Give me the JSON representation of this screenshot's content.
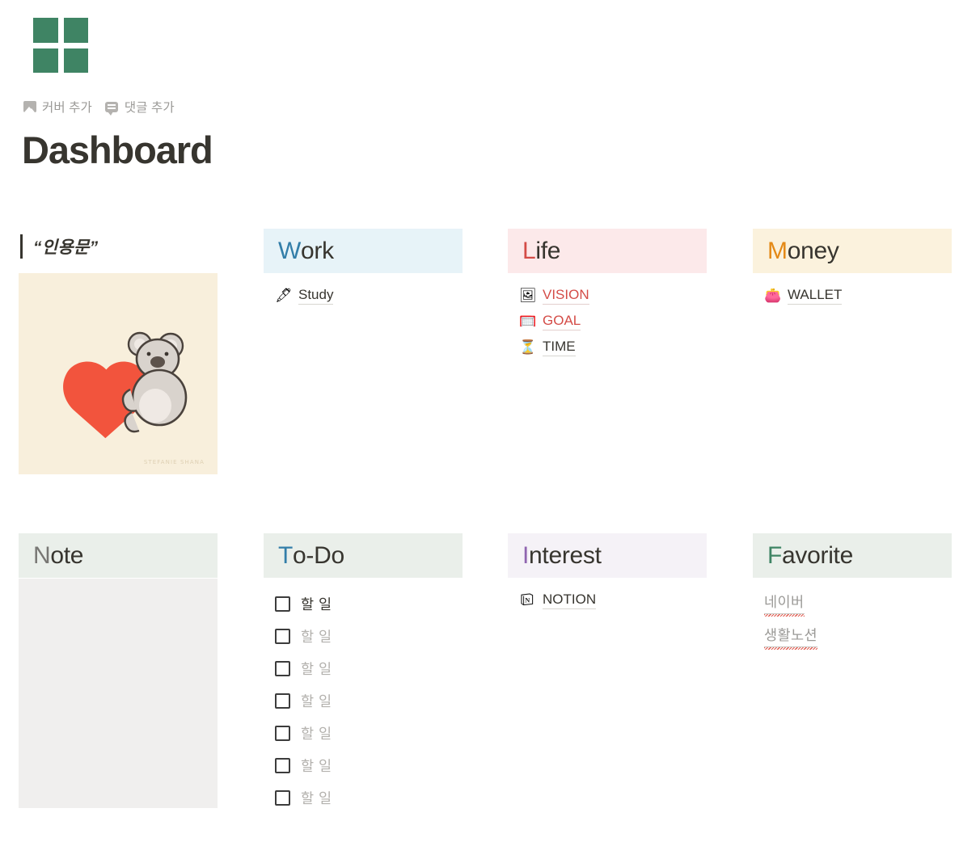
{
  "page": {
    "icon_name": "four-square-grid-icon",
    "icon_color": "#3f8464",
    "title": "Dashboard",
    "meta": [
      {
        "icon": "image-icon",
        "label": "커버 추가"
      },
      {
        "icon": "comment-bubble-icon",
        "label": "댓글 추가"
      }
    ]
  },
  "quote": {
    "text": "“인용문”"
  },
  "art": {
    "alt": "koala hugging a red heart illustration",
    "background": "#f8efdc",
    "watermark": "STEFANIE SHANA"
  },
  "sections": {
    "work": {
      "title_first": "W",
      "title_rest": "ork",
      "accent": "#337ea9",
      "bg": "#e7f3f8",
      "items": [
        {
          "icon": "🖋",
          "icon_name": "fountain-pen-icon",
          "label": "Study",
          "color": "dark"
        }
      ]
    },
    "life": {
      "title_first": "L",
      "title_rest": "ife",
      "accent": "#d44c47",
      "bg": "#fce9ea",
      "items": [
        {
          "icon": "🖼",
          "icon_name": "framed-picture-icon",
          "label": "VISION",
          "color": "red"
        },
        {
          "icon": "🥅",
          "icon_name": "goal-net-icon",
          "label": "GOAL",
          "color": "red"
        },
        {
          "icon": "⏳",
          "icon_name": "hourglass-icon",
          "label": "TIME",
          "color": "dark"
        }
      ]
    },
    "money": {
      "title_first": "M",
      "title_rest": "oney",
      "accent": "#e48a17",
      "bg": "#fbf2dd",
      "items": [
        {
          "icon": "👛",
          "icon_name": "purse-icon",
          "label": "WALLET",
          "color": "dark"
        }
      ]
    },
    "note": {
      "title_first": "N",
      "title_rest": "ote",
      "accent": "#787774",
      "bg": "#eaefea",
      "body_bg": "#f0efee",
      "content": ""
    },
    "todo": {
      "title_first": "T",
      "title_rest": "o-Do",
      "accent": "#337ea9",
      "bg": "#eaefea",
      "items": [
        {
          "label": "할 일",
          "checked": false,
          "muted": false
        },
        {
          "label": "할 일",
          "checked": false,
          "muted": true
        },
        {
          "label": "할 일",
          "checked": false,
          "muted": true
        },
        {
          "label": "할 일",
          "checked": false,
          "muted": true
        },
        {
          "label": "할 일",
          "checked": false,
          "muted": true
        },
        {
          "label": "할 일",
          "checked": false,
          "muted": true
        },
        {
          "label": "할 일",
          "checked": false,
          "muted": true
        }
      ]
    },
    "interest": {
      "title_first": "I",
      "title_rest": "nterest",
      "accent": "#9065b0",
      "bg": "#f5f2f7",
      "items": [
        {
          "icon": "N",
          "icon_name": "notion-logo-icon",
          "label": "NOTION",
          "color": "dark"
        }
      ]
    },
    "favorite": {
      "title_first": "F",
      "title_rest": "avorite",
      "accent": "#3f8464",
      "bg": "#eaefea",
      "links": [
        {
          "label": "네이버"
        },
        {
          "label": "생활노션"
        }
      ]
    }
  }
}
